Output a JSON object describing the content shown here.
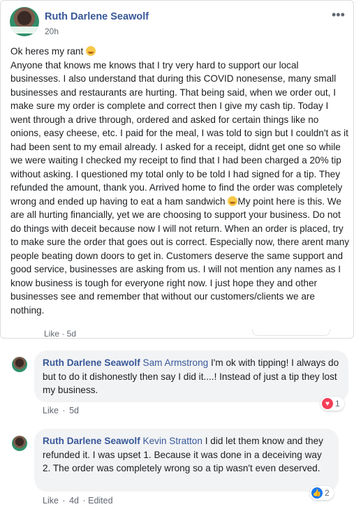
{
  "post": {
    "author": "Ruth Darlene Seawolf",
    "time": "20h",
    "more_icon": "•••",
    "avatar_band_text": "Ruth Darlene Seawolf",
    "text_lines": [
      "Ok heres my rant",
      "Anyone that knows me knows that I try very hard to support our local businesses. I also understand that during this COVID nonesense, many small businesses and restaurants are hurting. That being said, when we order out, I make sure my order is complete and correct then I give my cash tip. Today I went through a drive through, ordered and asked for certain things like no onions, easy cheese, etc. I paid for the meal, I was told to sign but I couldn't as it had been sent to my email already. I asked for a receipt, didnt get one so while we were waiting I checked my receipt to find that I had been charged a 20% tip without asking. I questioned my total only to be told I had signed for a tip. They refunded the amount, thank you. Arrived home to find the order was completely wrong and ended up having to eat a ham sandwich",
      "My point here is this. We are all hurting financially, yet we are choosing to support your business. Do not do things with deceit because now I will not return. When an order is placed, try to make sure the order that goes out is correct. Especially now, there arent many people beating down doors to get in. Customers deserve the same support and good service, businesses are asking from us. I will not mention any names as I know business is tough for everyone right now. I just hope they and other businesses see and remember that without our customers/clients we are nothing."
    ],
    "cut_meta": "Like · 5d"
  },
  "comments": [
    {
      "author": "Ruth Darlene Seawolf",
      "mention": "Sam Armstrong",
      "text": "I'm ok with tipping! I always do but to do it dishonestly then say I did it....! Instead of just a tip they lost my business.",
      "like": "Like",
      "sep": "·",
      "age": "5d",
      "edited": "",
      "reaction_icon": "heart-icon",
      "reaction_count": "1"
    },
    {
      "author": "Ruth Darlene Seawolf",
      "mention": "Kevin Stratton",
      "text": "I did let them know and they refunded it. I was upset 1. Because it was done in a deceiving way 2. The order was completely wrong so a tip wasn't even deserved.",
      "like": "Like",
      "sep": "·",
      "age": "4d",
      "edited": "· Edited",
      "reaction_icon": "like-icon",
      "reaction_count": "2"
    }
  ],
  "colors": {
    "name_blue": "#385898",
    "bubble_bg": "#f2f3f5",
    "heart": "#f33e58",
    "like": "#1877f2"
  }
}
